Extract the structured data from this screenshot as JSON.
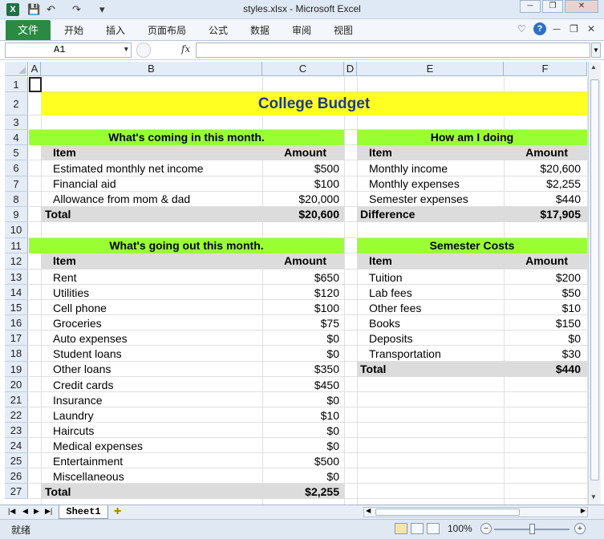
{
  "window": {
    "title": "styles.xlsx  -  Microsoft Excel",
    "app_icon_label": "X",
    "quick_access": {
      "save": "💾",
      "undo": "↶",
      "redo": "↷",
      "customize": "▾"
    },
    "controls": {
      "minimize": "─",
      "restore": "❐",
      "close": "✕"
    }
  },
  "ribbon": {
    "file_tab": "文件",
    "tabs": [
      "开始",
      "插入",
      "页面布局",
      "公式",
      "数据",
      "审阅",
      "视图"
    ],
    "help_label": "?"
  },
  "formula_bar": {
    "name_box": "A1",
    "fx_label": "fx",
    "content": ""
  },
  "columns": [
    "A",
    "B",
    "C",
    "D",
    "E",
    "F"
  ],
  "rows": [
    "1",
    "2",
    "3",
    "4",
    "5",
    "6",
    "7",
    "8",
    "9",
    "10",
    "11",
    "12",
    "13",
    "14",
    "15",
    "16",
    "17",
    "18",
    "19",
    "20",
    "21",
    "22",
    "23",
    "24",
    "25",
    "26",
    "27"
  ],
  "sheet": {
    "title": "College Budget",
    "income": {
      "header": "What's coming in this month.",
      "col_item": "Item",
      "col_amount": "Amount",
      "items": [
        {
          "item": "Estimated monthly net income",
          "amount": "$500"
        },
        {
          "item": "Financial aid",
          "amount": "$100"
        },
        {
          "item": "Allowance from mom & dad",
          "amount": "$20,000"
        }
      ],
      "total_label": "Total",
      "total_value": "$20,600"
    },
    "summary": {
      "header": "How am I doing",
      "col_item": "Item",
      "col_amount": "Amount",
      "items": [
        {
          "item": "Monthly income",
          "amount": "$20,600"
        },
        {
          "item": "Monthly expenses",
          "amount": "$2,255"
        },
        {
          "item": "Semester expenses",
          "amount": "$440"
        }
      ],
      "total_label": "Difference",
      "total_value": "$17,905"
    },
    "expenses": {
      "header": "What's going out this month.",
      "col_item": "Item",
      "col_amount": "Amount",
      "items": [
        {
          "item": "Rent",
          "amount": "$650"
        },
        {
          "item": "Utilities",
          "amount": "$120"
        },
        {
          "item": "Cell phone",
          "amount": "$100"
        },
        {
          "item": "Groceries",
          "amount": "$75"
        },
        {
          "item": "Auto expenses",
          "amount": "$0"
        },
        {
          "item": "Student loans",
          "amount": "$0"
        },
        {
          "item": "Other loans",
          "amount": "$350"
        },
        {
          "item": "Credit cards",
          "amount": "$450"
        },
        {
          "item": "Insurance",
          "amount": "$0"
        },
        {
          "item": "Laundry",
          "amount": "$10"
        },
        {
          "item": "Haircuts",
          "amount": "$0"
        },
        {
          "item": "Medical expenses",
          "amount": "$0"
        },
        {
          "item": "Entertainment",
          "amount": "$500"
        },
        {
          "item": "Miscellaneous",
          "amount": "$0"
        }
      ],
      "total_label": "Total",
      "total_value": "$2,255"
    },
    "semester": {
      "header": "Semester Costs",
      "col_item": "Item",
      "col_amount": "Amount",
      "items": [
        {
          "item": "Tuition",
          "amount": "$200"
        },
        {
          "item": "Lab fees",
          "amount": "$50"
        },
        {
          "item": "Other fees",
          "amount": "$10"
        },
        {
          "item": "Books",
          "amount": "$150"
        },
        {
          "item": "Deposits",
          "amount": "$0"
        },
        {
          "item": "Transportation",
          "amount": "$30"
        }
      ],
      "total_label": "Total",
      "total_value": "$440"
    }
  },
  "sheet_tabs": {
    "active": "Sheet1",
    "nav": [
      "|◀",
      "◀",
      "▶",
      "▶|"
    ]
  },
  "status": {
    "ready": "就绪",
    "zoom": "100%"
  },
  "colors": {
    "title_fill": "#ffff22",
    "title_text": "#1f3a93",
    "section_header_fill": "#99ff33",
    "column_header_fill": "#dcdcdc",
    "total_fill": "#dcdcdc"
  }
}
